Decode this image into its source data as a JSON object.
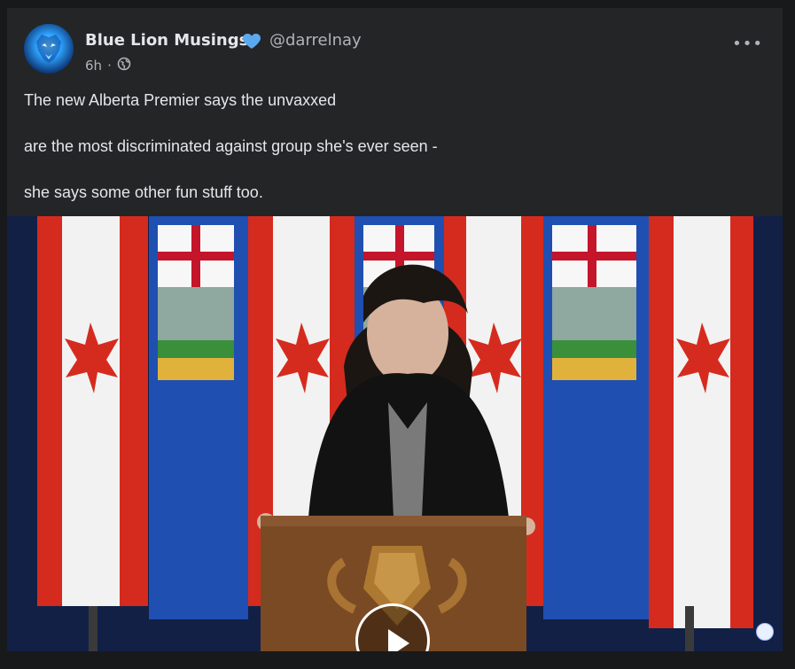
{
  "post": {
    "author": "Blue Lion Musings",
    "handle": "@darrelnay",
    "time": "6h",
    "separator": "·",
    "visibility_icon": "globe-icon",
    "verified_icon": "heart-icon",
    "more_label": "•••",
    "lines": [
      "The new Alberta Premier says the unvaxxed",
      "are the most discriminated against group she's ever seen -",
      "she says some other fun stuff too."
    ]
  },
  "colors": {
    "background": "#18191a",
    "card": "#242526",
    "text": "#e4e6eb",
    "secondary_text": "#b0b3b8",
    "verified": "#5aa9f0",
    "canada_red": "#d52b1e",
    "alberta_blue": "#1f4fb0"
  }
}
